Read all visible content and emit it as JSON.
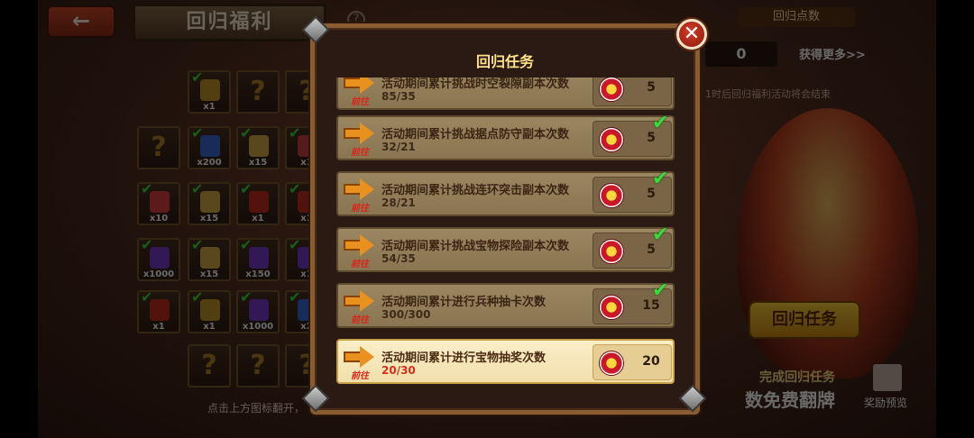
{
  "background": {
    "back_label": "←",
    "title": "回归福利",
    "help": "?",
    "bottom_hint": "点击上方图标翻开，",
    "cards": [
      {
        "type": "item",
        "count": "x1",
        "checked": true,
        "color": "#c79a2a"
      },
      {
        "type": "unknown",
        "count": "",
        "checked": false,
        "color": ""
      },
      {
        "type": "unknown",
        "count": "",
        "checked": false,
        "color": ""
      },
      {
        "type": "unknown",
        "count": "",
        "checked": false,
        "color": ""
      },
      {
        "type": "item",
        "count": "x200",
        "checked": true,
        "color": "#3a6ad8"
      },
      {
        "type": "item",
        "count": "x15",
        "checked": true,
        "color": "#d8b04a"
      },
      {
        "type": "item",
        "count": "x1",
        "checked": true,
        "color": "#d04040"
      },
      {
        "type": "item",
        "count": "x10",
        "checked": true,
        "color": "#e04040"
      },
      {
        "type": "item",
        "count": "x15",
        "checked": true,
        "color": "#d8b04a"
      },
      {
        "type": "item",
        "count": "x1",
        "checked": true,
        "color": "#c83020"
      },
      {
        "type": "item",
        "count": "x1",
        "checked": true,
        "color": "#c83020"
      },
      {
        "type": "item",
        "count": "x1000",
        "checked": true,
        "color": "#7a3ad0"
      },
      {
        "type": "item",
        "count": "x15",
        "checked": true,
        "color": "#d8b04a"
      },
      {
        "type": "item",
        "count": "x150",
        "checked": true,
        "color": "#7a3ad0"
      },
      {
        "type": "item",
        "count": "x1",
        "checked": true,
        "color": "#7a3ad0"
      },
      {
        "type": "item",
        "count": "x1",
        "checked": true,
        "color": "#c83020"
      },
      {
        "type": "item",
        "count": "x1",
        "checked": true,
        "color": "#c79a2a"
      },
      {
        "type": "item",
        "count": "x1000",
        "checked": true,
        "color": "#7a3ad0"
      },
      {
        "type": "item",
        "count": "x2",
        "checked": true,
        "color": "#3a6ad8"
      },
      {
        "type": "unknown",
        "count": "",
        "checked": false,
        "color": ""
      },
      {
        "type": "unknown",
        "count": "",
        "checked": false,
        "color": ""
      },
      {
        "type": "unknown",
        "count": "",
        "checked": false,
        "color": ""
      }
    ],
    "right": {
      "points_title": "回归点数",
      "points_value": "0",
      "get_more": "获得更多>>",
      "countdown": "1时后回归福利活动将会结束",
      "recall_button": "回归任务",
      "complete_text": "完成回归任务",
      "free_flip": "数免费翻牌",
      "reward_preview": "奖励预览"
    }
  },
  "dialog": {
    "title": "回归任务",
    "close": "✕",
    "goto_label": "前往",
    "tasks": [
      {
        "desc": "活动期间累计挑战时空裂隙副本次数",
        "progress": "85/35",
        "reward": "5",
        "done": false
      },
      {
        "desc": "活动期间累计挑战据点防守副本次数",
        "progress": "32/21",
        "reward": "5",
        "done": true
      },
      {
        "desc": "活动期间累计挑战连环突击副本次数",
        "progress": "28/21",
        "reward": "5",
        "done": true
      },
      {
        "desc": "活动期间累计挑战宝物探险副本次数",
        "progress": "54/35",
        "reward": "5",
        "done": true
      },
      {
        "desc": "活动期间累计进行兵种抽卡次数",
        "progress": "300/300",
        "reward": "15",
        "done": true
      },
      {
        "desc": "活动期间累计进行宝物抽奖次数",
        "progress": "20/30",
        "reward": "20",
        "done": false,
        "active": true
      }
    ]
  },
  "colors": {
    "accent_gold": "#ffe28a",
    "progress_red": "#d0301a",
    "done_green": "#3dd83d"
  }
}
